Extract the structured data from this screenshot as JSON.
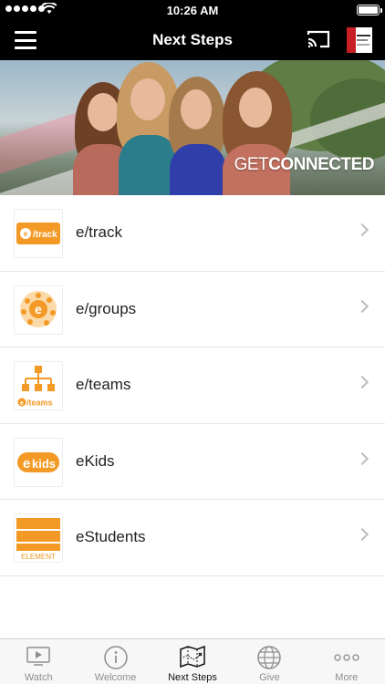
{
  "status_bar": {
    "time": "10:26 AM"
  },
  "nav": {
    "title": "Next Steps"
  },
  "banner": {
    "caption_light": "GET",
    "caption_bold": "CONNECTED"
  },
  "items": [
    {
      "label": "e/track",
      "icon": "etrack-logo"
    },
    {
      "label": "e/groups",
      "icon": "egroups-logo"
    },
    {
      "label": "e/teams",
      "icon": "eteams-logo"
    },
    {
      "label": "eKids",
      "icon": "ekids-logo"
    },
    {
      "label": "eStudents",
      "icon": "element-logo"
    }
  ],
  "icon_texts": {
    "track": "/track",
    "teams": "/teams",
    "kids": "kids",
    "element": "ELEMENT"
  },
  "tabs": [
    {
      "label": "Watch",
      "icon": "play-icon"
    },
    {
      "label": "Welcome",
      "icon": "info-icon"
    },
    {
      "label": "Next Steps",
      "icon": "map-icon",
      "active": true
    },
    {
      "label": "Give",
      "icon": "globe-icon"
    },
    {
      "label": "More",
      "icon": "more-icon"
    }
  ],
  "colors": {
    "brand_orange": "#f39a26",
    "bar_black": "#000000",
    "active_tab": "#111111",
    "inactive_tab": "#8e8e8e"
  }
}
